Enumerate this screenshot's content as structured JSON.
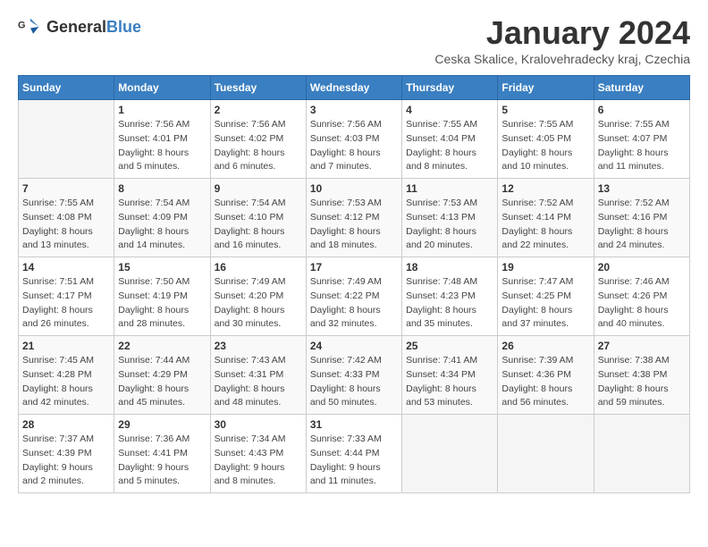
{
  "header": {
    "logo_general": "General",
    "logo_blue": "Blue",
    "title": "January 2024",
    "subtitle": "Ceska Skalice, Kralovehradecky kraj, Czechia"
  },
  "calendar": {
    "columns": [
      "Sunday",
      "Monday",
      "Tuesday",
      "Wednesday",
      "Thursday",
      "Friday",
      "Saturday"
    ],
    "weeks": [
      [
        {
          "day": "",
          "info": ""
        },
        {
          "day": "1",
          "info": "Sunrise: 7:56 AM\nSunset: 4:01 PM\nDaylight: 8 hours\nand 5 minutes."
        },
        {
          "day": "2",
          "info": "Sunrise: 7:56 AM\nSunset: 4:02 PM\nDaylight: 8 hours\nand 6 minutes."
        },
        {
          "day": "3",
          "info": "Sunrise: 7:56 AM\nSunset: 4:03 PM\nDaylight: 8 hours\nand 7 minutes."
        },
        {
          "day": "4",
          "info": "Sunrise: 7:55 AM\nSunset: 4:04 PM\nDaylight: 8 hours\nand 8 minutes."
        },
        {
          "day": "5",
          "info": "Sunrise: 7:55 AM\nSunset: 4:05 PM\nDaylight: 8 hours\nand 10 minutes."
        },
        {
          "day": "6",
          "info": "Sunrise: 7:55 AM\nSunset: 4:07 PM\nDaylight: 8 hours\nand 11 minutes."
        }
      ],
      [
        {
          "day": "7",
          "info": "Sunrise: 7:55 AM\nSunset: 4:08 PM\nDaylight: 8 hours\nand 13 minutes."
        },
        {
          "day": "8",
          "info": "Sunrise: 7:54 AM\nSunset: 4:09 PM\nDaylight: 8 hours\nand 14 minutes."
        },
        {
          "day": "9",
          "info": "Sunrise: 7:54 AM\nSunset: 4:10 PM\nDaylight: 8 hours\nand 16 minutes."
        },
        {
          "day": "10",
          "info": "Sunrise: 7:53 AM\nSunset: 4:12 PM\nDaylight: 8 hours\nand 18 minutes."
        },
        {
          "day": "11",
          "info": "Sunrise: 7:53 AM\nSunset: 4:13 PM\nDaylight: 8 hours\nand 20 minutes."
        },
        {
          "day": "12",
          "info": "Sunrise: 7:52 AM\nSunset: 4:14 PM\nDaylight: 8 hours\nand 22 minutes."
        },
        {
          "day": "13",
          "info": "Sunrise: 7:52 AM\nSunset: 4:16 PM\nDaylight: 8 hours\nand 24 minutes."
        }
      ],
      [
        {
          "day": "14",
          "info": "Sunrise: 7:51 AM\nSunset: 4:17 PM\nDaylight: 8 hours\nand 26 minutes."
        },
        {
          "day": "15",
          "info": "Sunrise: 7:50 AM\nSunset: 4:19 PM\nDaylight: 8 hours\nand 28 minutes."
        },
        {
          "day": "16",
          "info": "Sunrise: 7:49 AM\nSunset: 4:20 PM\nDaylight: 8 hours\nand 30 minutes."
        },
        {
          "day": "17",
          "info": "Sunrise: 7:49 AM\nSunset: 4:22 PM\nDaylight: 8 hours\nand 32 minutes."
        },
        {
          "day": "18",
          "info": "Sunrise: 7:48 AM\nSunset: 4:23 PM\nDaylight: 8 hours\nand 35 minutes."
        },
        {
          "day": "19",
          "info": "Sunrise: 7:47 AM\nSunset: 4:25 PM\nDaylight: 8 hours\nand 37 minutes."
        },
        {
          "day": "20",
          "info": "Sunrise: 7:46 AM\nSunset: 4:26 PM\nDaylight: 8 hours\nand 40 minutes."
        }
      ],
      [
        {
          "day": "21",
          "info": "Sunrise: 7:45 AM\nSunset: 4:28 PM\nDaylight: 8 hours\nand 42 minutes."
        },
        {
          "day": "22",
          "info": "Sunrise: 7:44 AM\nSunset: 4:29 PM\nDaylight: 8 hours\nand 45 minutes."
        },
        {
          "day": "23",
          "info": "Sunrise: 7:43 AM\nSunset: 4:31 PM\nDaylight: 8 hours\nand 48 minutes."
        },
        {
          "day": "24",
          "info": "Sunrise: 7:42 AM\nSunset: 4:33 PM\nDaylight: 8 hours\nand 50 minutes."
        },
        {
          "day": "25",
          "info": "Sunrise: 7:41 AM\nSunset: 4:34 PM\nDaylight: 8 hours\nand 53 minutes."
        },
        {
          "day": "26",
          "info": "Sunrise: 7:39 AM\nSunset: 4:36 PM\nDaylight: 8 hours\nand 56 minutes."
        },
        {
          "day": "27",
          "info": "Sunrise: 7:38 AM\nSunset: 4:38 PM\nDaylight: 8 hours\nand 59 minutes."
        }
      ],
      [
        {
          "day": "28",
          "info": "Sunrise: 7:37 AM\nSunset: 4:39 PM\nDaylight: 9 hours\nand 2 minutes."
        },
        {
          "day": "29",
          "info": "Sunrise: 7:36 AM\nSunset: 4:41 PM\nDaylight: 9 hours\nand 5 minutes."
        },
        {
          "day": "30",
          "info": "Sunrise: 7:34 AM\nSunset: 4:43 PM\nDaylight: 9 hours\nand 8 minutes."
        },
        {
          "day": "31",
          "info": "Sunrise: 7:33 AM\nSunset: 4:44 PM\nDaylight: 9 hours\nand 11 minutes."
        },
        {
          "day": "",
          "info": ""
        },
        {
          "day": "",
          "info": ""
        },
        {
          "day": "",
          "info": ""
        }
      ]
    ]
  }
}
